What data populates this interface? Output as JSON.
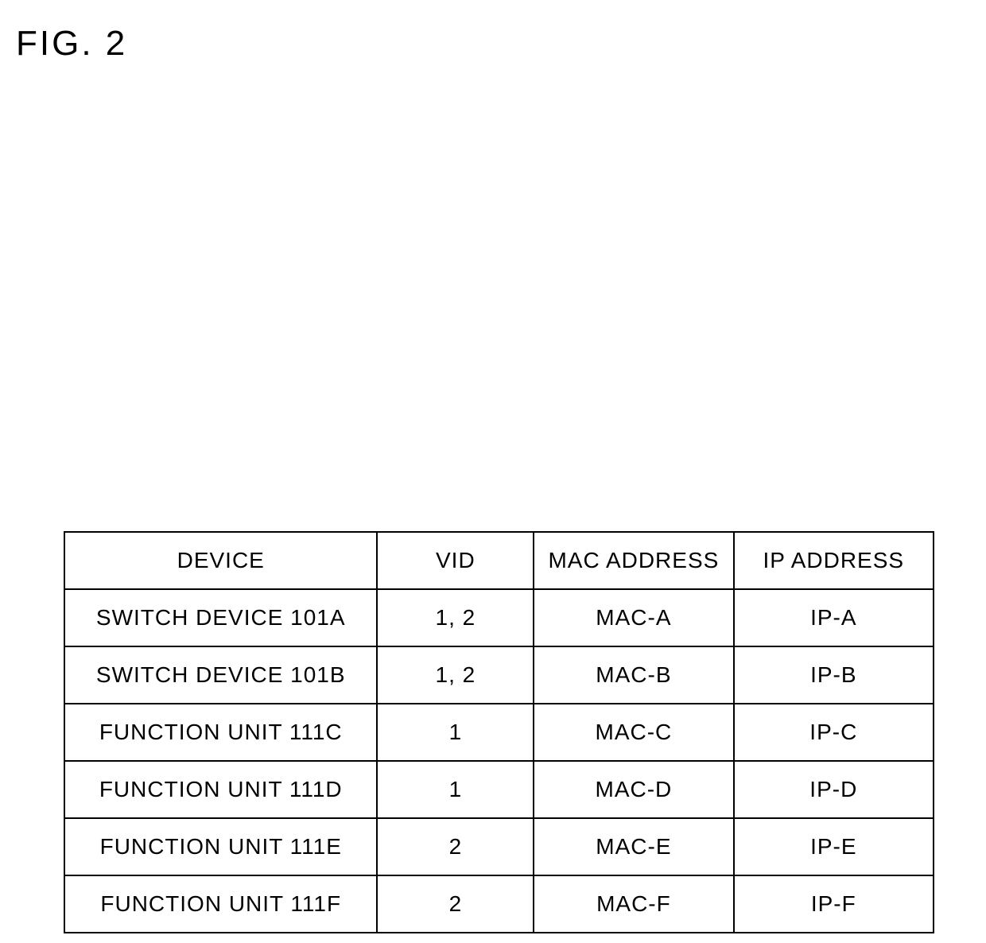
{
  "figure_label": "FIG. 2",
  "chart_data": {
    "type": "table",
    "headers": [
      "DEVICE",
      "VID",
      "MAC ADDRESS",
      "IP ADDRESS"
    ],
    "rows": [
      {
        "device": "SWITCH DEVICE 101A",
        "vid": "1, 2",
        "mac": "MAC-A",
        "ip": "IP-A"
      },
      {
        "device": "SWITCH DEVICE 101B",
        "vid": "1, 2",
        "mac": "MAC-B",
        "ip": "IP-B"
      },
      {
        "device": "FUNCTION UNIT 111C",
        "vid": "1",
        "mac": "MAC-C",
        "ip": "IP-C"
      },
      {
        "device": "FUNCTION UNIT 111D",
        "vid": "1",
        "mac": "MAC-D",
        "ip": "IP-D"
      },
      {
        "device": "FUNCTION UNIT 111E",
        "vid": "2",
        "mac": "MAC-E",
        "ip": "IP-E"
      },
      {
        "device": "FUNCTION UNIT 111F",
        "vid": "2",
        "mac": "MAC-F",
        "ip": "IP-F"
      }
    ]
  }
}
